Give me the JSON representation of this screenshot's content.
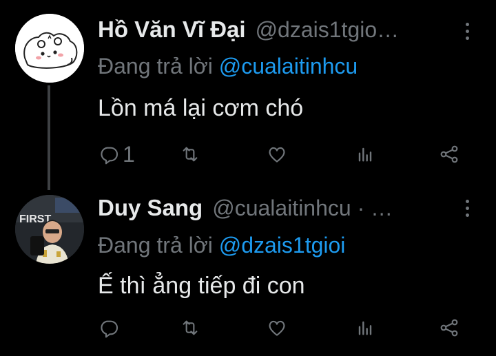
{
  "tweets": [
    {
      "name": "Hồ Văn Vĩ Đại",
      "handle": "@dzais1tgio…",
      "reply_prefix": "Đang trả lời ",
      "reply_to": "@cualaitinhcu",
      "text": "Lồn má lại cơm chó",
      "reply_count": "1"
    },
    {
      "name": "Duy Sang",
      "handle": "@cualaitinhcu · …",
      "reply_prefix": "Đang trả lời ",
      "reply_to": "@dzais1tgioi",
      "text": "Ế thì ẳng tiếp đi con",
      "reply_count": ""
    }
  ],
  "colors": {
    "background": "#000000",
    "text": "#e7e9ea",
    "muted": "#71767b",
    "link": "#1d9bf0"
  }
}
